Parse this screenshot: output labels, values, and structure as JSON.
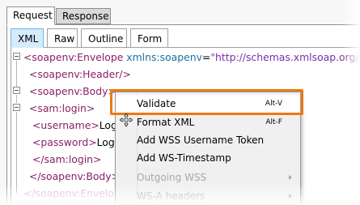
{
  "outer_tabs": [
    {
      "label": "Request",
      "active": true
    },
    {
      "label": "Response",
      "active": false
    }
  ],
  "inner_tabs": [
    {
      "label": "XML",
      "active": true
    },
    {
      "label": "Raw",
      "active": false
    },
    {
      "label": "Outline",
      "active": false
    },
    {
      "label": "Form",
      "active": false
    }
  ],
  "code_lines": [
    {
      "tag": "<soapenv:Envelope",
      "attr": " xmlns:soapenv",
      "eq": "=",
      "str": "\"http://schemas.xmlsoap.org/so"
    },
    {
      "tag": "<soapenv:Header/>"
    },
    {
      "tag": "<soapenv:Body>"
    },
    {
      "tag": "<sam:login>"
    },
    {
      "tag": "<username>",
      "text": "Login"
    },
    {
      "tag": "<password>",
      "text": "Login"
    },
    {
      "tag": "</sam:login>"
    },
    {
      "tag": "</soapenv:Body>"
    },
    {
      "tag": "</soapenv:Envelope"
    }
  ],
  "context_menu": {
    "items": [
      {
        "label": "Validate",
        "shortcut": "Alt-V",
        "enabled": true
      },
      {
        "label": "Format XML",
        "shortcut": "Alt-F",
        "enabled": true
      },
      {
        "label": "Add WSS Username Token",
        "enabled": true
      },
      {
        "label": "Add WS-Timestamp",
        "enabled": true
      },
      {
        "label": "Outgoing WSS",
        "enabled": false,
        "submenu": true
      },
      {
        "label": "WS-A headers",
        "enabled": false,
        "submenu": true
      }
    ]
  },
  "colors": {
    "highlight": "#ec7a12",
    "tag": "#8a1f6a",
    "attribute": "#1f6fa0",
    "string": "#7c2da7",
    "active_tab": "#d3ebfa"
  }
}
